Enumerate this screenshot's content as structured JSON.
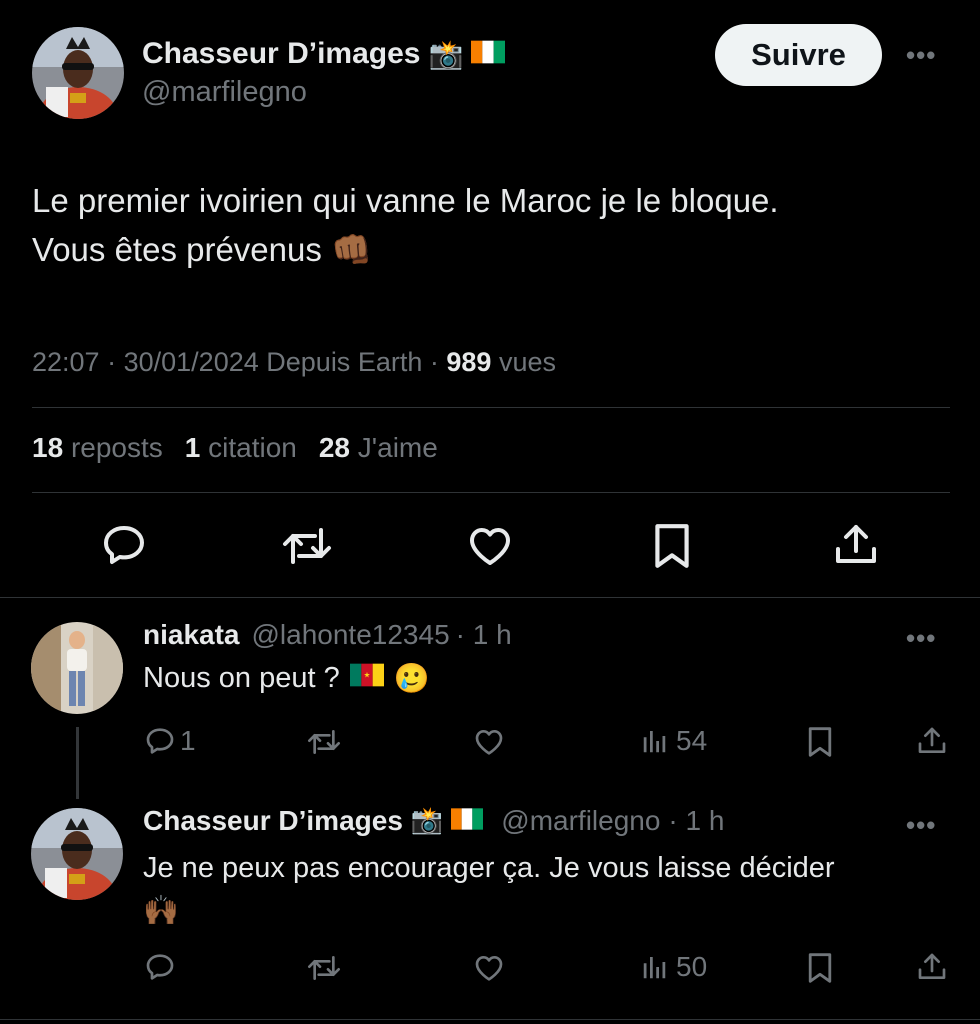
{
  "main_tweet": {
    "author_name": "Chasseur D’images",
    "author_emojis": "📸",
    "author_handle": "@marfilegno",
    "follow_label": "Suivre",
    "more_label": "•••",
    "text_line1": "Le premier ivoirien qui vanne le Maroc je le bloque.",
    "text_line2": "Vous êtes prévenus",
    "text_emoji": "👊🏾",
    "time": "22:07",
    "sep1": "·",
    "date": "30/01/2024",
    "source": "Depuis Earth",
    "sep2": "·",
    "views_count": "989",
    "views_label": "vues",
    "reposts_count": "18",
    "reposts_label": "reposts",
    "quotes_count": "1",
    "quotes_label": "citation",
    "likes_count": "28",
    "likes_label": "J'aime"
  },
  "replies": [
    {
      "author_name": "niakata",
      "author_handle": "@lahonte12345",
      "time": "· 1 h",
      "text": "Nous on peut ?",
      "emoji": "🥲",
      "reply_count": "1",
      "views_count": "54"
    },
    {
      "author_name": "Chasseur D’images",
      "author_emojis": "📸",
      "author_handle": "@marfilegno",
      "time": "· 1 h",
      "text": "Je ne peux pas encourager ça. Je vous laisse décider",
      "emoji": "🙌🏾",
      "views_count": "50"
    }
  ],
  "colors": {
    "background": "#000000",
    "text": "#e7e9ea",
    "muted": "#71767b",
    "divider": "#2f3336",
    "follow_bg": "#eff3f4"
  }
}
